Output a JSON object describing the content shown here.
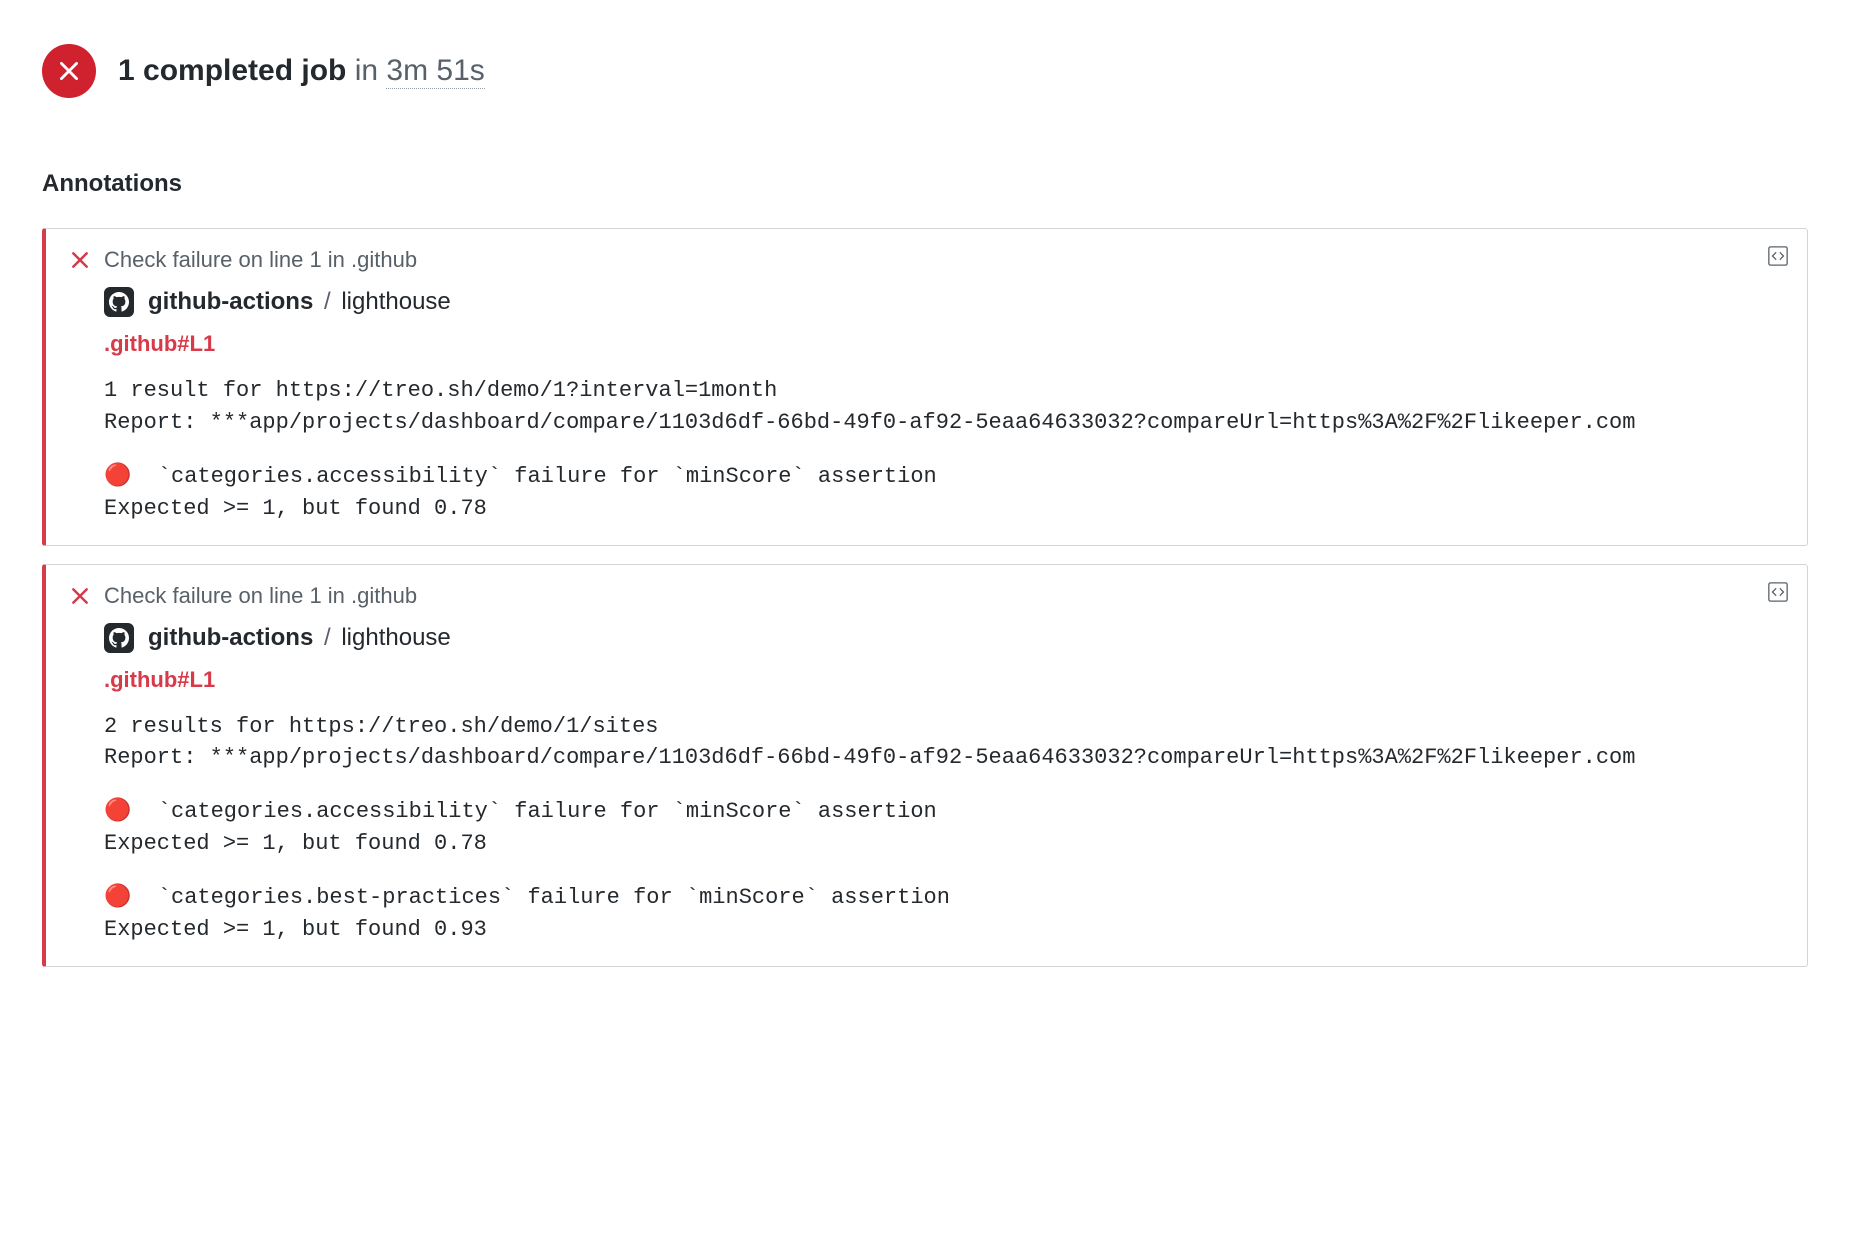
{
  "header": {
    "count_label": "1 completed job",
    "in_label": "in",
    "duration": "3m 51s"
  },
  "section_title": "Annotations",
  "annotations": [
    {
      "header_text": "Check failure on line 1 in .github",
      "actor": "github-actions",
      "check": "lighthouse",
      "file_link": ".github#L1",
      "lines": [
        "1 result for https://treo.sh/demo/1?interval=1month",
        "Report: ***app/projects/dashboard/compare/1103d6df-66bd-49f0-af92-5eaa64633032?compareUrl=https%3A%2F%2Flikeeper.com"
      ],
      "failures": [
        {
          "text": "🔴  `categories.accessibility` failure for `minScore` assertion",
          "expected": "Expected >= 1, but found 0.78"
        }
      ]
    },
    {
      "header_text": "Check failure on line 1 in .github",
      "actor": "github-actions",
      "check": "lighthouse",
      "file_link": ".github#L1",
      "lines": [
        "2 results for https://treo.sh/demo/1/sites",
        "Report: ***app/projects/dashboard/compare/1103d6df-66bd-49f0-af92-5eaa64633032?compareUrl=https%3A%2F%2Flikeeper.com"
      ],
      "failures": [
        {
          "text": "🔴  `categories.accessibility` failure for `minScore` assertion",
          "expected": "Expected >= 1, but found 0.78"
        },
        {
          "text": "🔴  `categories.best-practices` failure for `minScore` assertion",
          "expected": "Expected >= 1, but found 0.93"
        }
      ]
    }
  ]
}
